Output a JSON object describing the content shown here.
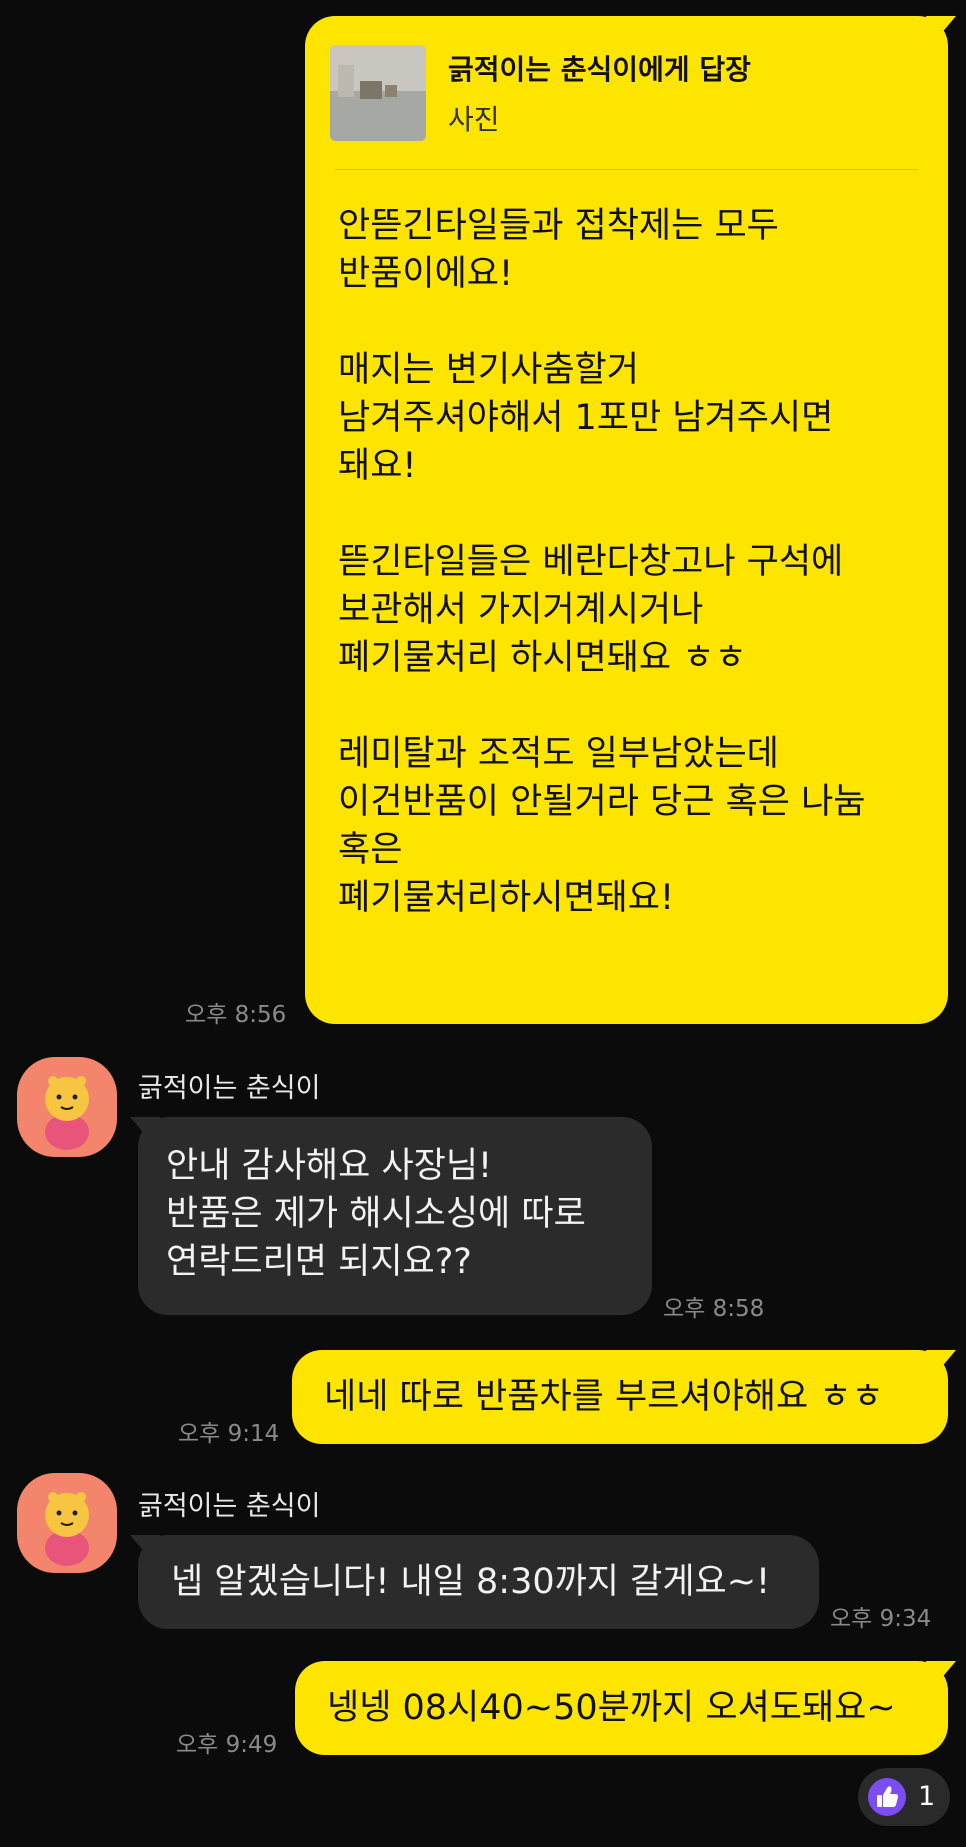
{
  "messages": {
    "m1": {
      "reply_title": "긁적이는 춘식이에게 답장",
      "reply_subtitle": "사진",
      "lines": [
        "안뜯긴타일들과 접착제는 모두",
        "반품이에요!",
        "",
        "매지는 변기사춤할거",
        "남겨주셔야해서 1포만 남겨주시면",
        "돼요!",
        "",
        "뜯긴타일들은 베란다창고나 구석에",
        "보관해서 가지거계시거나",
        "폐기물처리 하시면돼요 ㅎㅎ",
        "",
        "레미탈과 조적도 일부남았는데",
        "이건반품이 안될거라 당근 혹은 나눔",
        "혹은",
        "폐기물처리하시면돼요!"
      ],
      "time": "오후 8:56"
    },
    "m2": {
      "sender": "긁적이는 춘식이",
      "lines": [
        "안내 감사해요 사장님!",
        "반품은 제가 해시소싱에 따로",
        "연락드리면 되지요??"
      ],
      "time": "오후 8:58"
    },
    "m3": {
      "text": "네네 따로 반품차를 부르셔야해요 ㅎㅎ",
      "time": "오후 9:14"
    },
    "m4": {
      "sender": "긁적이는 춘식이",
      "text": "넵 알겠습니다! 내일 8:30까지 갈게요~!",
      "time": "오후 9:34"
    },
    "m5": {
      "text": "넹넹 08시40~50분까지 오셔도돼요~",
      "time": "오후 9:49"
    }
  },
  "reaction": {
    "icon": "thumbs-up-icon",
    "count": "1"
  },
  "colors": {
    "my_bubble": "#fee500",
    "their_bubble": "#2b2b2b",
    "background": "#0b0b0b",
    "avatar_bg": "#f2856b",
    "reaction_purple": "#7b4df2"
  }
}
